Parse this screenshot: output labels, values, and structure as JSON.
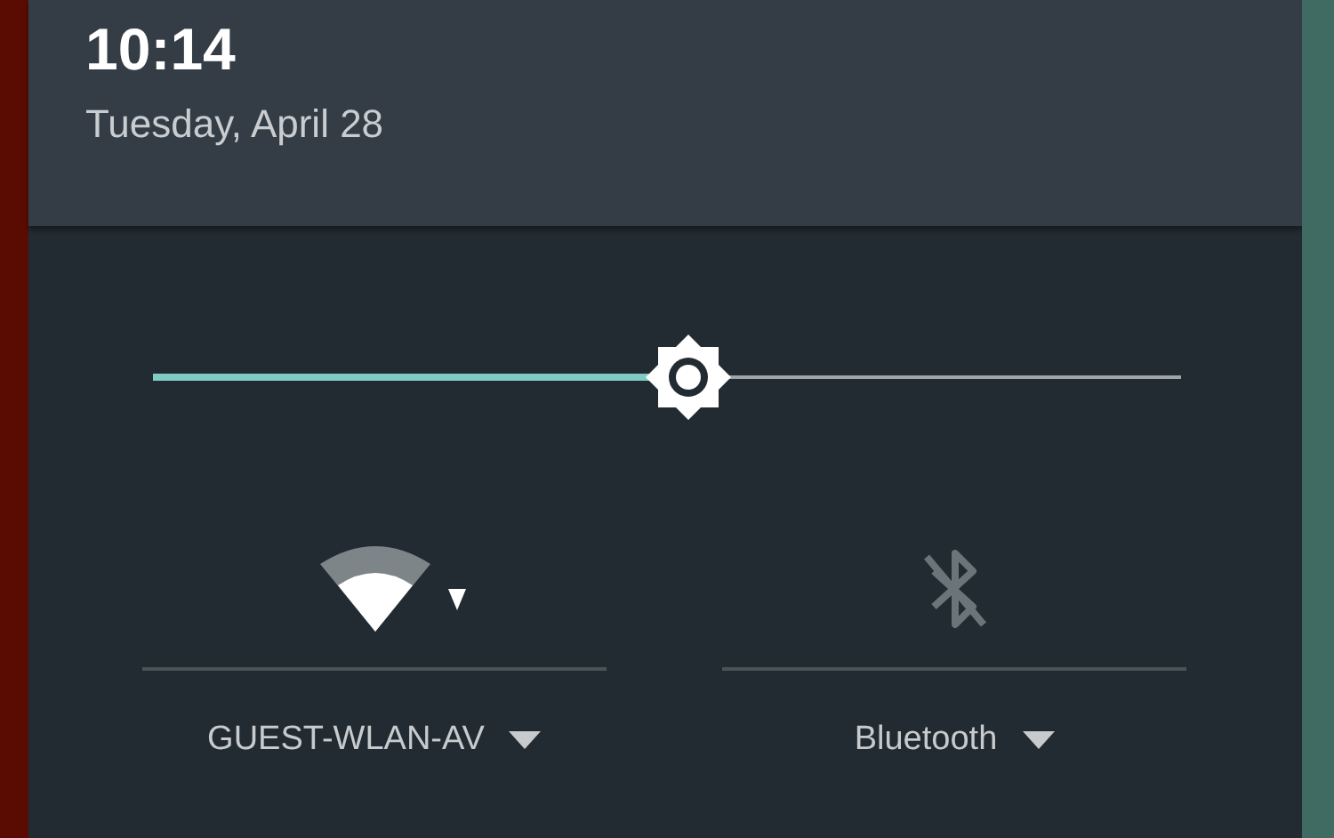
{
  "clock": {
    "time": "10:14",
    "date": "Tuesday, April 28"
  },
  "brightness": {
    "level": 0.52
  },
  "tiles": [
    {
      "kind": "wifi",
      "label": "GUEST-WLAN-AV",
      "on": true
    },
    {
      "kind": "bluetooth",
      "label": "Bluetooth",
      "on": false
    }
  ]
}
